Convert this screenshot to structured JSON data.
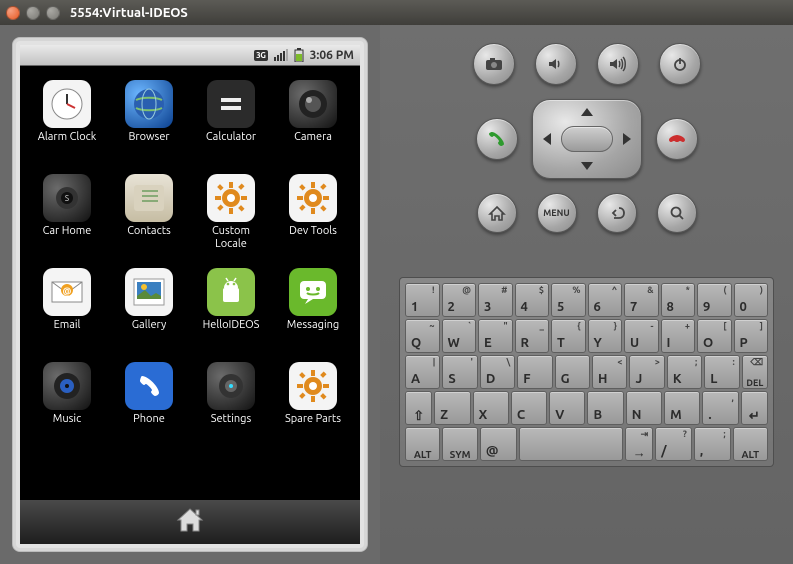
{
  "window": {
    "title": "5554:Virtual-IDEOS"
  },
  "status": {
    "threeg": "3G",
    "time": "3:06 PM"
  },
  "apps": [
    {
      "label": "Alarm Clock",
      "bg": "#f4f4f4",
      "icon": "clock"
    },
    {
      "label": "Browser",
      "bg": "radial-gradient(circle at 30% 30%,#6cb6ff,#0a3f8e)",
      "icon": "globe"
    },
    {
      "label": "Calculator",
      "bg": "#2b2b2b",
      "icon": "equals"
    },
    {
      "label": "Camera",
      "bg": "radial-gradient(circle at 30% 30%,#6b6b6b,#111)",
      "icon": "lens"
    },
    {
      "label": "Car Home",
      "bg": "radial-gradient(circle at 30% 30%,#6b6b6b,#111)",
      "icon": "car"
    },
    {
      "label": "Contacts",
      "bg": "linear-gradient(#e8e3d6,#c6bda3)",
      "icon": "book"
    },
    {
      "label": "Custom\nLocale",
      "bg": "#f4f4f4",
      "icon": "gear"
    },
    {
      "label": "Dev Tools",
      "bg": "#f4f4f4",
      "icon": "gear"
    },
    {
      "label": "Email",
      "bg": "#f4f4f4",
      "icon": "mail"
    },
    {
      "label": "Gallery",
      "bg": "#f4f4f4",
      "icon": "gallery"
    },
    {
      "label": "HelloIDEOS",
      "bg": "#8bc34a",
      "icon": "droid"
    },
    {
      "label": "Messaging",
      "bg": "#6ab92c",
      "icon": "msg"
    },
    {
      "label": "Music",
      "bg": "radial-gradient(circle at 30% 30%,#6b6b6b,#111)",
      "icon": "music"
    },
    {
      "label": "Phone",
      "bg": "#2a6cd4",
      "icon": "phone"
    },
    {
      "label": "Settings",
      "bg": "radial-gradient(circle at 30% 30%,#6b6b6b,#111)",
      "icon": "gear2"
    },
    {
      "label": "Spare Parts",
      "bg": "#f4f4f4",
      "icon": "gear"
    }
  ],
  "hw_row1": [
    "camera",
    "volume-down",
    "volume-up",
    "power"
  ],
  "hw_nav": [
    "call",
    "dpad",
    "end"
  ],
  "hw_row3": [
    "home",
    "menu",
    "back",
    "search"
  ],
  "menu_label": "MENU",
  "keyboard": {
    "row1": [
      {
        "m": "1",
        "a": "!"
      },
      {
        "m": "2",
        "a": "@"
      },
      {
        "m": "3",
        "a": "#"
      },
      {
        "m": "4",
        "a": "$"
      },
      {
        "m": "5",
        "a": "%"
      },
      {
        "m": "6",
        "a": "^"
      },
      {
        "m": "7",
        "a": "&"
      },
      {
        "m": "8",
        "a": "*"
      },
      {
        "m": "9",
        "a": "("
      },
      {
        "m": "0",
        "a": ")"
      }
    ],
    "row2": [
      {
        "m": "Q",
        "a": "~"
      },
      {
        "m": "W",
        "a": "`"
      },
      {
        "m": "E",
        "a": "\""
      },
      {
        "m": "R",
        "a": "_"
      },
      {
        "m": "T",
        "a": "{"
      },
      {
        "m": "Y",
        "a": "}"
      },
      {
        "m": "U",
        "a": "-"
      },
      {
        "m": "I",
        "a": "+"
      },
      {
        "m": "O",
        "a": "["
      },
      {
        "m": "P",
        "a": "]"
      }
    ],
    "row3": [
      {
        "m": "A",
        "a": "|"
      },
      {
        "m": "S",
        "a": "'"
      },
      {
        "m": "D",
        "a": "\\"
      },
      {
        "m": "F",
        "a": ""
      },
      {
        "m": "G",
        "a": ""
      },
      {
        "m": "H",
        "a": "<"
      },
      {
        "m": "J",
        "a": ">"
      },
      {
        "m": "K",
        "a": ";"
      },
      {
        "m": "L",
        "a": ":"
      },
      {
        "m": "DEL",
        "a": "",
        "del": true
      }
    ],
    "row4": [
      {
        "m": "⇧",
        "shift": true
      },
      {
        "m": "Z"
      },
      {
        "m": "X"
      },
      {
        "m": "C"
      },
      {
        "m": "V"
      },
      {
        "m": "B"
      },
      {
        "m": "N"
      },
      {
        "m": "M"
      },
      {
        "m": ".",
        "a": ","
      },
      {
        "m": "↵",
        "enter": true
      }
    ],
    "row5": [
      {
        "m": "ALT",
        "alt": true
      },
      {
        "m": "SYM",
        "sym": true
      },
      {
        "m": "@",
        "at": true
      },
      {
        "m": " ",
        "space": true
      },
      {
        "m": "→",
        "a": "⇥",
        "rarr": true
      },
      {
        "m": "/",
        "a": "?"
      },
      {
        "m": ",",
        "a": ";"
      },
      {
        "m": "ALT",
        "alt": true
      }
    ]
  }
}
